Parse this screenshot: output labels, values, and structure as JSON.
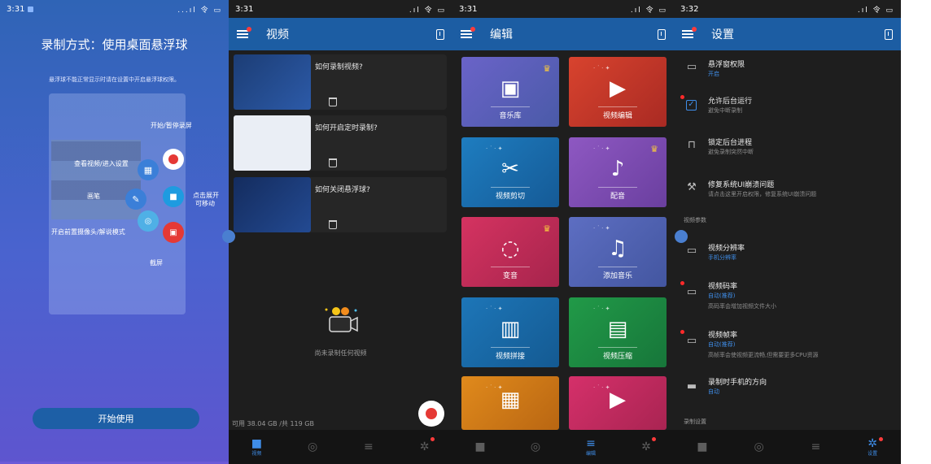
{
  "panel1": {
    "status": {
      "time": "3:31",
      "icons": "...ıl 令 ▭"
    },
    "heading": "录制方式：使用桌面悬浮球",
    "notice": "悬浮球不能正常显示时请在设置中开启悬浮球权限。",
    "overlay": {
      "start_pause": "开始/暂停录屏",
      "view_videos": "查看视频/进入设置",
      "brush": "画笔",
      "expand": "点击展开",
      "movable": "可移动",
      "camera": "开启前置摄像头/解说模式",
      "screenshot": "截屏"
    },
    "start_button": "开始使用"
  },
  "panel2": {
    "status": {
      "time": "3:31",
      "icons": ".ıl 令 ▭"
    },
    "title": "视频",
    "videos": [
      {
        "title": "如何录制视频?"
      },
      {
        "title": "如何开启定时录制?"
      },
      {
        "title": "如何关闭悬浮球?"
      }
    ],
    "empty_text": "尚未录制任何视频",
    "storage": "可用 38.04 GB /共 119 GB",
    "nav": [
      {
        "label": "视频",
        "icon": "camera-icon"
      },
      {
        "label": "",
        "icon": "screenshot-icon"
      },
      {
        "label": "",
        "icon": "tools-icon"
      },
      {
        "label": "",
        "icon": "settings-icon"
      }
    ]
  },
  "panel3": {
    "status": {
      "time": "3:31",
      "icons": ".ıl 令 ▭"
    },
    "title": "编辑",
    "tiles": [
      {
        "label": "音乐库",
        "color": "#5a5fb8",
        "crown": true
      },
      {
        "label": "视频编辑",
        "color": "#c9392b",
        "crown": false
      },
      {
        "label": "视频剪切",
        "color": "#1d6fae",
        "crown": false
      },
      {
        "label": "配音",
        "color": "#7c4fb2",
        "crown": true
      },
      {
        "label": "变音",
        "color": "#c22d55",
        "crown": true
      },
      {
        "label": "添加音乐",
        "color": "#5163b3",
        "crown": false
      },
      {
        "label": "视频拼接",
        "color": "#1a6aa8",
        "crown": false
      },
      {
        "label": "视频压缩",
        "color": "#1c8a3e",
        "crown": false
      }
    ],
    "nav": [
      {
        "label": "",
        "icon": "camera-icon"
      },
      {
        "label": "",
        "icon": "screenshot-icon"
      },
      {
        "label": "编辑",
        "icon": "tools-icon"
      },
      {
        "label": "",
        "icon": "settings-icon"
      }
    ]
  },
  "panel4": {
    "status": {
      "time": "3:32",
      "icons": ".ıl 令 ▭"
    },
    "title": "设置",
    "items": [
      {
        "title": "悬浮窗权限",
        "sub": "开启"
      },
      {
        "title": "允许后台运行",
        "sub": "避免中断录制"
      },
      {
        "title": "锁定后台进程",
        "sub": "避免录制突然中断"
      },
      {
        "title": "修复系统UI崩溃问题",
        "sub": "请点击这里开启权限，修复系统UI崩溃问题"
      }
    ],
    "section_video": "视频参数",
    "video_items": [
      {
        "title": "视频分辨率",
        "sub": "手机分辨率"
      },
      {
        "title": "视频码率",
        "sub": "自动(推荐)",
        "sub2": "高码率会增加视频文件大小"
      },
      {
        "title": "视频帧率",
        "sub": "自动(推荐)",
        "sub2": "高帧率会使视频更流畅,但需要更多CPU资源"
      },
      {
        "title": "录制时手机的方向",
        "sub": "自动"
      }
    ],
    "section_record": "录制设置",
    "nav": [
      {
        "label": "",
        "icon": "camera-icon"
      },
      {
        "label": "",
        "icon": "screenshot-icon"
      },
      {
        "label": "",
        "icon": "tools-icon"
      },
      {
        "label": "设置",
        "icon": "settings-icon"
      }
    ]
  }
}
